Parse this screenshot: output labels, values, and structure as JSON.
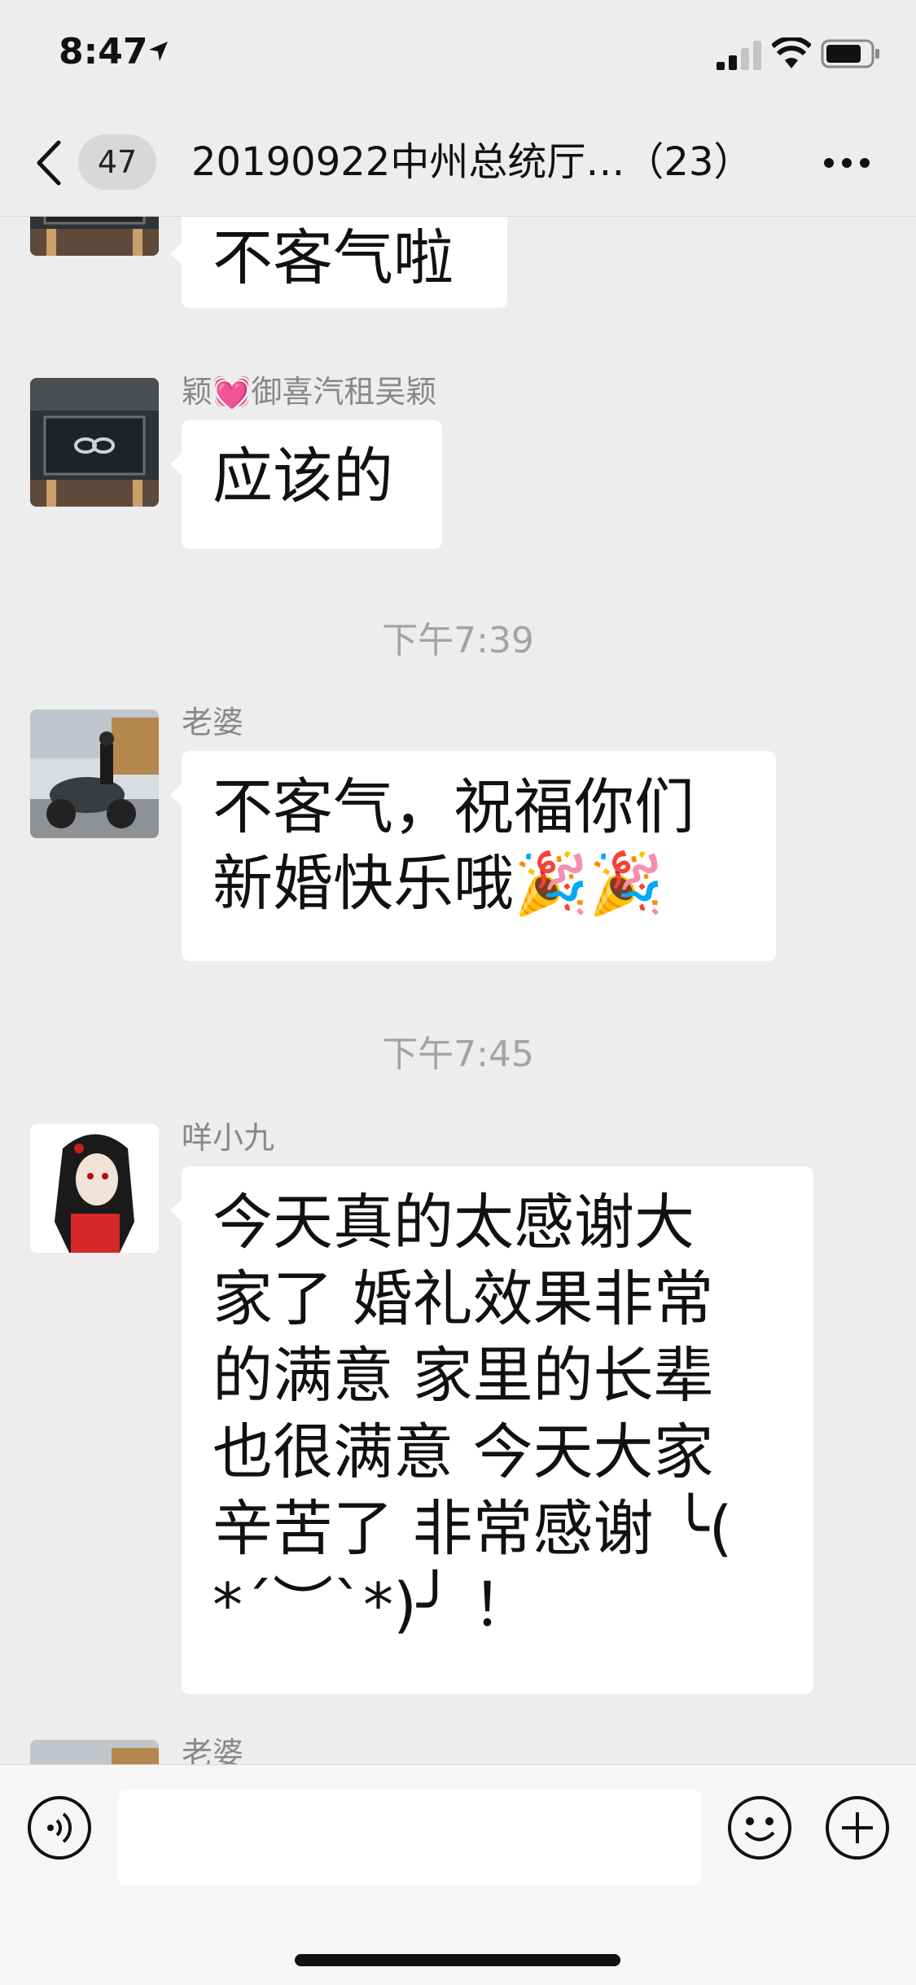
{
  "status_bar": {
    "time": "8:47",
    "icons": [
      "location-arrow-icon",
      "signal-icon",
      "wifi-icon",
      "battery-icon"
    ]
  },
  "nav": {
    "back_icon": "chevron-left-icon",
    "unread_count": "47",
    "title": "20190922中州总统厅…（23）",
    "more_icon": "more-dots-icon"
  },
  "messages": [
    {
      "type": "text",
      "sender": "",
      "text": "不客气啦",
      "avatar": "building-avatar"
    },
    {
      "type": "text",
      "sender": "颖💓御喜汽租吴颖",
      "text": "应该的",
      "avatar": "building-avatar"
    },
    {
      "type": "time",
      "text": "下午7:39"
    },
    {
      "type": "text",
      "sender": "老婆",
      "lines": [
        "不客气，祝福你们",
        "新婚快乐哦🎉🎉"
      ],
      "avatar": "motorcycle-avatar"
    },
    {
      "type": "time",
      "text": "下午7:45"
    },
    {
      "type": "text",
      "sender": "咩小九",
      "lines": [
        "今天真的太感谢大",
        "家了 婚礼效果非常",
        "的满意 家里的长辈",
        "也很满意 今天大家",
        "辛苦了 非常感谢 ╰(",
        "*´︶`*)╯ ！"
      ],
      "avatar": "anime-girl-avatar"
    },
    {
      "type": "text",
      "sender": "老婆",
      "text": "",
      "avatar": "motorcycle-avatar"
    }
  ],
  "input_bar": {
    "voice_icon": "voice-icon",
    "input_value": "",
    "emoji_icon": "emoji-icon",
    "add_icon": "plus-circle-icon"
  },
  "colors": {
    "background": "#ededed",
    "bubble": "#ffffff",
    "sender_text": "#888888",
    "timestamp_text": "#a3a3a3"
  }
}
